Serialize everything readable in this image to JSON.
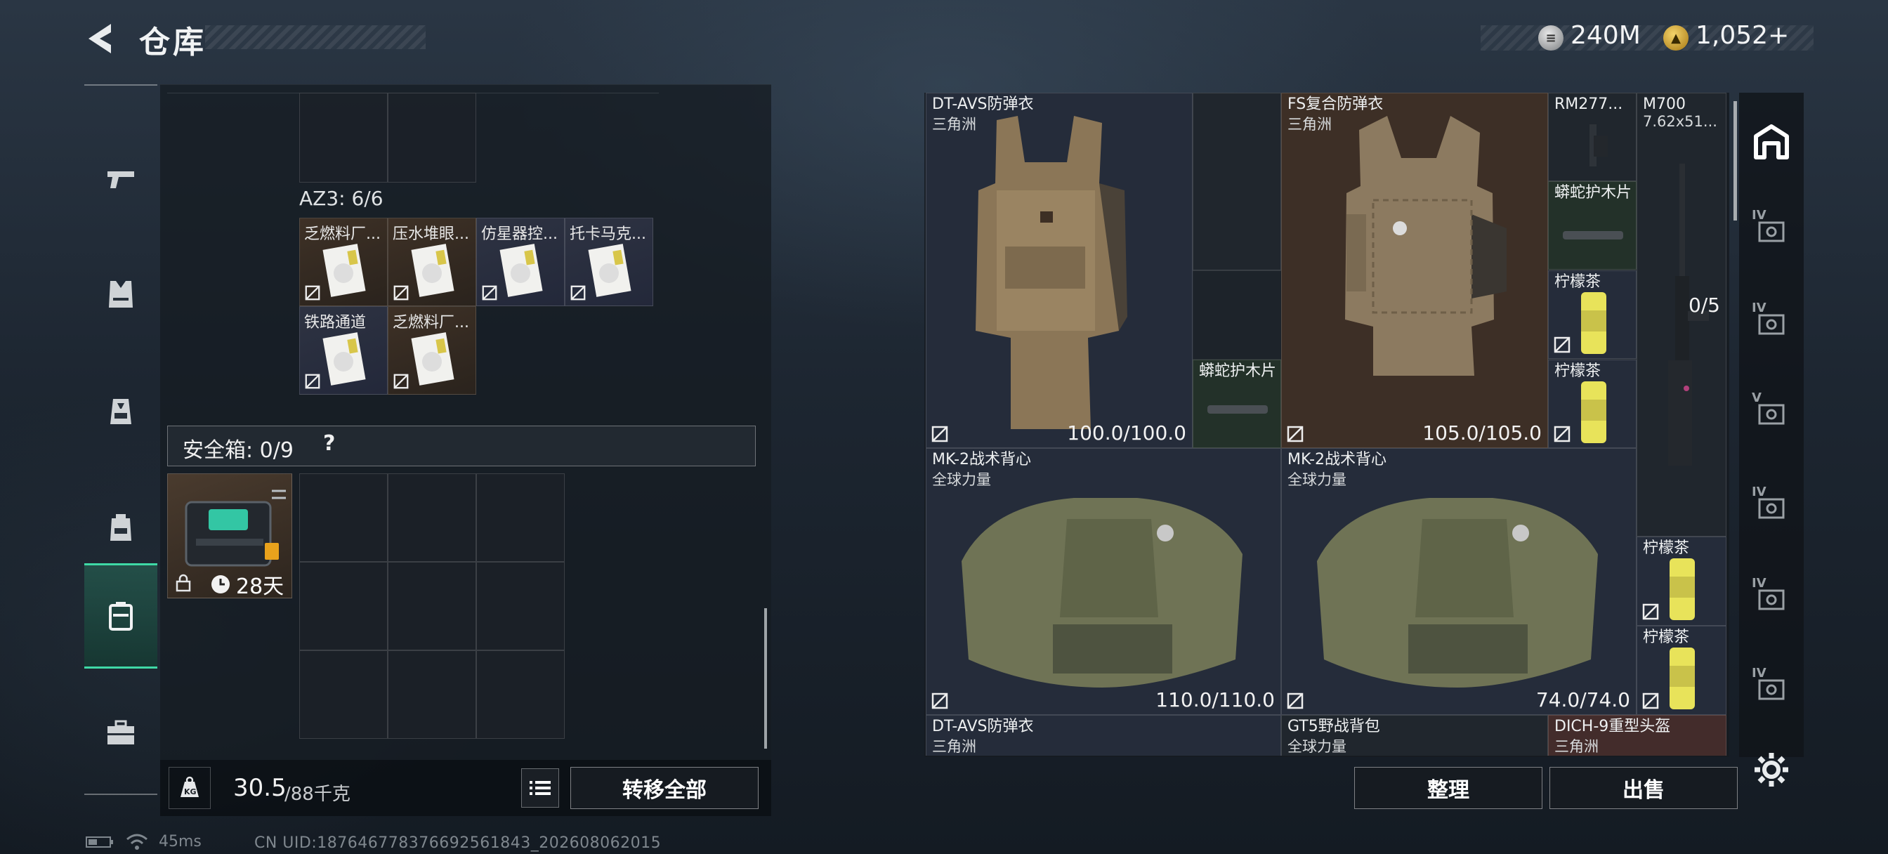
{
  "header": {
    "title": "仓库",
    "money": "240M",
    "coupons": "1,052",
    "coupons_plus": "+"
  },
  "left": {
    "rail_icons": [
      "pistol-icon",
      "vest-icon",
      "backpack-icon",
      "bag-icon",
      "safebox-icon",
      "case-icon"
    ],
    "active_rail": 4,
    "az3_label": "AZ3: 6/6",
    "az3_items": [
      {
        "name": "乏燃料厂...",
        "tone": "brown"
      },
      {
        "name": "压水堆眼...",
        "tone": "brown"
      },
      {
        "name": "仿星器控...",
        "tone": "blue"
      },
      {
        "name": "托卡马克...",
        "tone": "blue"
      },
      {
        "name": "铁路通道",
        "tone": "blue"
      },
      {
        "name": "乏燃料厂...",
        "tone": "brown"
      }
    ],
    "safe_label": "安全箱: 0/9",
    "safe_help": "?",
    "safebox_days": "28天",
    "weight_current": "30.5",
    "weight_max": "/88千克",
    "transfer_all": "转移全部"
  },
  "right": {
    "items": [
      {
        "name": "DT-AVS防弹衣",
        "sub": "三角洲",
        "dur": "100.0/100.0"
      },
      {
        "name": "FS复合防弹衣",
        "sub": "三角洲",
        "dur": "105.0/105.0"
      },
      {
        "name": "RM277...",
        "sub": ""
      },
      {
        "name": "M700",
        "sub": "7.62x51...",
        "count": "0/5"
      },
      {
        "name": "蟒蛇护木片",
        "sub": ""
      },
      {
        "name": "蟒蛇护木片",
        "sub": ""
      },
      {
        "name": "柠檬茶",
        "sub": ""
      },
      {
        "name": "柠檬茶",
        "sub": ""
      },
      {
        "name": "MK-2战术背心",
        "sub": "全球力量",
        "dur": "110.0/110.0"
      },
      {
        "name": "MK-2战术背心",
        "sub": "全球力量",
        "dur": "74.0/74.0"
      },
      {
        "name": "柠檬茶",
        "sub": ""
      },
      {
        "name": "柠檬茶",
        "sub": ""
      },
      {
        "name": "DT-AVS防弹衣",
        "sub": "三角洲"
      },
      {
        "name": "GT5野战背包",
        "sub": "全球力量"
      },
      {
        "name": "DICH-9重型头盔",
        "sub": "三角洲"
      }
    ],
    "sort": "整理",
    "sell": "出售",
    "filter_labels": [
      "IV",
      "IV",
      "V",
      "IV",
      "IV",
      "IV"
    ]
  },
  "status": {
    "ping": "45ms",
    "uid": "CN UID:187646778376692561843_202608062015"
  }
}
